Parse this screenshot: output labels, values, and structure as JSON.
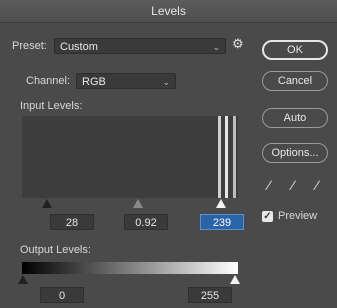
{
  "window": {
    "title": "Levels"
  },
  "preset": {
    "label": "Preset:",
    "value": "Custom",
    "gear_icon": "gear-icon"
  },
  "channel": {
    "label": "Channel:",
    "value": "RGB"
  },
  "input_levels": {
    "label": "Input Levels:",
    "black": "28",
    "gamma": "0.92",
    "white": "239"
  },
  "output_levels": {
    "label": "Output Levels:",
    "black": "0",
    "white": "255"
  },
  "buttons": {
    "ok": "OK",
    "cancel": "Cancel",
    "auto": "Auto",
    "options": "Options..."
  },
  "preview": {
    "label": "Preview",
    "checked": true
  },
  "icons": {
    "chevron": "chevron-down-icon",
    "black_eyedropper": "eyedropper-black-icon",
    "gray_eyedropper": "eyedropper-gray-icon",
    "white_eyedropper": "eyedropper-white-icon"
  },
  "colors": {
    "panel": "#4a4a4a",
    "active_field": "#2b63a8",
    "histogram_bg": "#3d3d3d"
  }
}
